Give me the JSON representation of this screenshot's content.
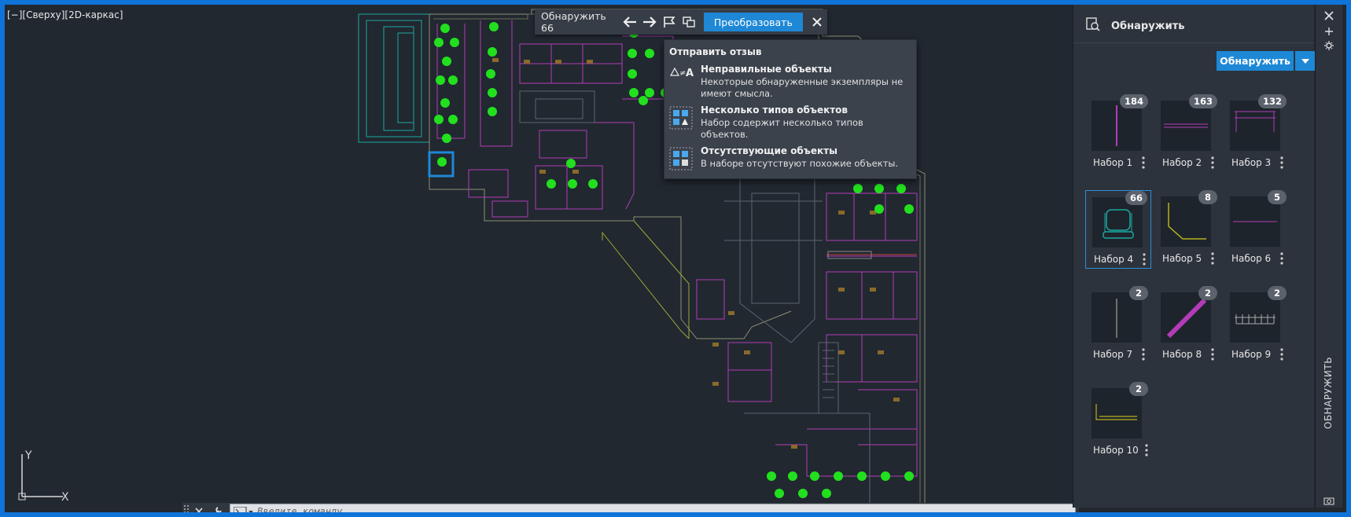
{
  "viewport": {
    "label": "[−][Сверху][2D-каркас]",
    "ucs_y": "Y",
    "ucs_x": "X"
  },
  "toolbar": {
    "detect_label": "Обнаружить 66",
    "convert_label": "Преобразовать",
    "icons": [
      "arrow-left-icon",
      "arrow-right-icon",
      "flag-icon",
      "copy-icon",
      "close-icon"
    ]
  },
  "feedback": {
    "title": "Отправить отзыв",
    "items": [
      {
        "heading": "Неправильные объекты",
        "desc": "Некоторые обнаруженные экземпляры не имеют смысла."
      },
      {
        "heading": "Несколько типов объектов",
        "desc": "Набор содержит несколько типов объектов."
      },
      {
        "heading": "Отсутствующие объекты",
        "desc": "В наборе отсутствуют похожие объекты."
      }
    ]
  },
  "panel": {
    "title": "Обнаружить",
    "detect_button": "Обнаружить",
    "rail_title": "ОБНАРУЖИТЬ",
    "sets": [
      {
        "name": "Набор 1",
        "count": "184"
      },
      {
        "name": "Набор 2",
        "count": "163"
      },
      {
        "name": "Набор 3",
        "count": "132"
      },
      {
        "name": "Набор 4",
        "count": "66"
      },
      {
        "name": "Набор 5",
        "count": "8"
      },
      {
        "name": "Набор 6",
        "count": "5"
      },
      {
        "name": "Набор 7",
        "count": "2"
      },
      {
        "name": "Набор 8",
        "count": "2"
      },
      {
        "name": "Набор 9",
        "count": "2"
      },
      {
        "name": "Набор 10",
        "count": "2"
      }
    ],
    "selected_set": "Набор 4"
  },
  "command_line": {
    "placeholder": "Введите команду"
  },
  "colors": {
    "accent": "#1e88d6",
    "canvas": "#212830",
    "panel": "#2d333c",
    "detected_marker": "#22e01e"
  }
}
